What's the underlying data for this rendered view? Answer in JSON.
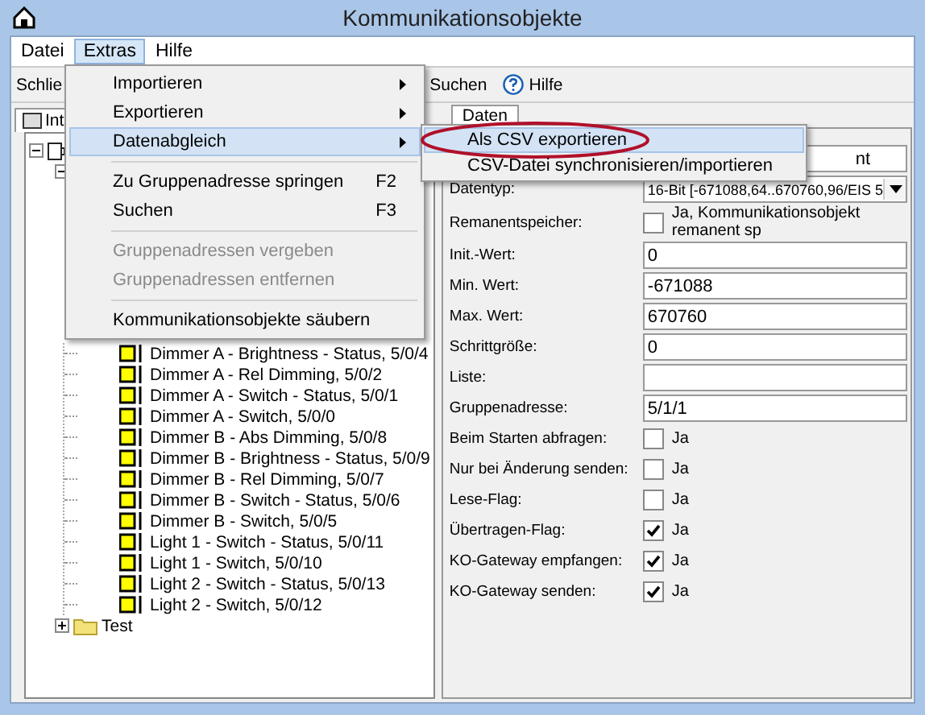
{
  "window": {
    "title": "Kommunikationsobjekte"
  },
  "menu_bar": [
    {
      "label": "Datei",
      "selected": false
    },
    {
      "label": "Extras",
      "selected": true
    },
    {
      "label": "Hilfe",
      "selected": false
    }
  ],
  "toolbar": [
    {
      "kind": "text",
      "label": "Schlie"
    },
    {
      "kind": "text",
      "label": "Suchen"
    },
    {
      "kind": "help",
      "label": "Hilfe"
    }
  ],
  "left_tab": {
    "label": "Int"
  },
  "tree": [
    {
      "expanded": true,
      "children": [
        {
          "expanded": true,
          "children": [
            {
              "label": "Dimmer A - Brightness - Status, 5/0/4"
            },
            {
              "label": "Dimmer A - Rel Dimming, 5/0/2"
            },
            {
              "label": "Dimmer A - Switch - Status, 5/0/1"
            },
            {
              "label": "Dimmer A - Switch, 5/0/0"
            },
            {
              "label": "Dimmer B - Abs Dimming, 5/0/8"
            },
            {
              "label": "Dimmer B - Brightness - Status, 5/0/9"
            },
            {
              "label": "Dimmer B - Rel Dimming, 5/0/7"
            },
            {
              "label": "Dimmer B - Switch - Status, 5/0/6"
            },
            {
              "label": "Dimmer B - Switch, 5/0/5"
            },
            {
              "label": "Light 1 - Switch - Status, 5/0/11"
            },
            {
              "label": "Light 1 - Switch, 5/0/10"
            },
            {
              "label": "Light 2 - Switch - Status, 5/0/13"
            },
            {
              "label": "Light 2 - Switch, 5/0/12"
            }
          ]
        },
        {
          "label": "Test",
          "expanded": false
        }
      ]
    }
  ],
  "right_tab": {
    "label": "Daten"
  },
  "fields": [
    {
      "kind": "text",
      "value": "nt"
    },
    {
      "kind": "select",
      "label": "Datentyp:",
      "value": "16-Bit [-671088,64..670760,96/EIS 5"
    },
    {
      "kind": "checkbox",
      "label": "Remanentspeicher:",
      "checked": false,
      "text": "Ja, Kommunikationsobjekt remanent sp"
    },
    {
      "kind": "text",
      "label": "Init.-Wert:",
      "value": "0"
    },
    {
      "kind": "text",
      "label": "Min. Wert:",
      "value": "-671088"
    },
    {
      "kind": "text",
      "label": "Max. Wert:",
      "value": "670760"
    },
    {
      "kind": "text",
      "label": "Schrittgröße:",
      "value": "0"
    },
    {
      "kind": "text",
      "label": "Liste:"
    },
    {
      "kind": "text",
      "label": "Gruppenadresse:",
      "value": "5/1/1"
    },
    {
      "kind": "checkbox",
      "label": "Beim Starten abfragen:",
      "checked": false,
      "text": "Ja"
    },
    {
      "kind": "checkbox",
      "label": "Nur bei Änderung senden:",
      "checked": false,
      "text": "Ja"
    },
    {
      "kind": "checkbox",
      "label": "Lese-Flag:",
      "checked": false,
      "text": "Ja"
    },
    {
      "kind": "checkbox",
      "label": "Übertragen-Flag:",
      "checked": true,
      "text": "Ja"
    },
    {
      "kind": "checkbox",
      "label": "KO-Gateway empfangen:",
      "checked": true,
      "text": "Ja"
    },
    {
      "kind": "checkbox",
      "label": "KO-Gateway senden:",
      "checked": true,
      "text": "Ja"
    }
  ],
  "extras_menu": [
    {
      "kind": "item",
      "label": "Importieren",
      "submenu": true,
      "disabled": false,
      "selected": false
    },
    {
      "kind": "item",
      "label": "Exportieren",
      "submenu": true,
      "disabled": false,
      "selected": false
    },
    {
      "kind": "item",
      "label": "Datenabgleich",
      "submenu": true,
      "disabled": false,
      "selected": true
    },
    {
      "kind": "separator"
    },
    {
      "kind": "item",
      "label": "Zu Gruppenadresse springen",
      "shortcut": "F2",
      "submenu": false,
      "disabled": false,
      "selected": false
    },
    {
      "kind": "item",
      "label": "Suchen",
      "shortcut": "F3",
      "submenu": false,
      "disabled": false,
      "selected": false
    },
    {
      "kind": "separator"
    },
    {
      "kind": "item",
      "label": "Gruppenadressen vergeben",
      "submenu": false,
      "disabled": true,
      "selected": false
    },
    {
      "kind": "item",
      "label": "Gruppenadressen entfernen",
      "submenu": false,
      "disabled": true,
      "selected": false
    },
    {
      "kind": "separator"
    },
    {
      "kind": "item",
      "label": "Kommunikationsobjekte säubern",
      "submenu": false,
      "disabled": false,
      "selected": false
    }
  ],
  "submenu": [
    {
      "label": "Als CSV exportieren",
      "selected": true,
      "circled": true
    },
    {
      "label": "CSV-Datei synchronisieren/importieren",
      "selected": false,
      "circled": false
    }
  ]
}
